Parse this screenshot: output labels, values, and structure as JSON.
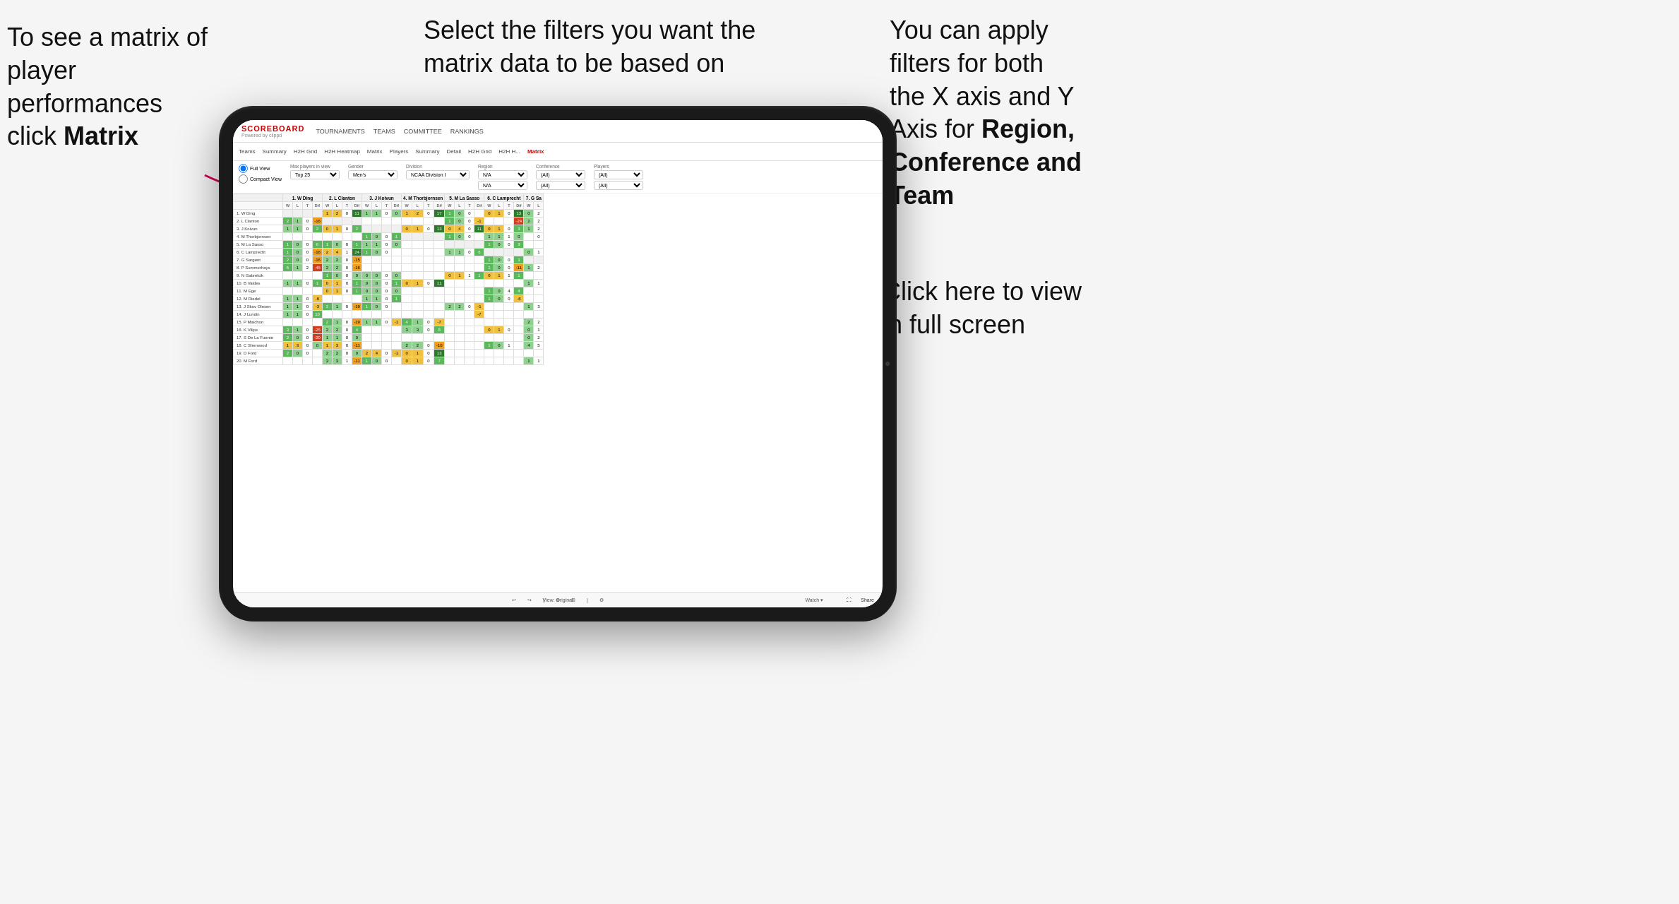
{
  "annotations": {
    "left": {
      "line1": "To see a matrix of",
      "line2": "player performances",
      "line3_plain": "click ",
      "line3_bold": "Matrix"
    },
    "center": {
      "text": "Select the filters you want the matrix data to be based on"
    },
    "right_top": {
      "line1": "You  can apply",
      "line2": "filters for both",
      "line3": "the X axis and Y",
      "line4_plain": "Axis for ",
      "line4_bold": "Region,",
      "line5_bold": "Conference and",
      "line6_bold": "Team"
    },
    "right_bottom": {
      "line1": "Click here to view",
      "line2": "in full screen"
    }
  },
  "nav": {
    "logo_main": "SCOREBOARD",
    "logo_sub": "Powered by clippd",
    "items": [
      "TOURNAMENTS",
      "TEAMS",
      "COMMITTEE",
      "RANKINGS"
    ]
  },
  "subnav": {
    "items": [
      "Teams",
      "Summary",
      "H2H Grid",
      "H2H Heatmap",
      "Matrix",
      "Players",
      "Summary",
      "Detail",
      "H2H Grid",
      "H2H H...",
      "Matrix"
    ],
    "active_index": 10
  },
  "filters": {
    "view_options": [
      "Full View",
      "Compact View"
    ],
    "max_players_label": "Max players in view",
    "max_players_value": "Top 25",
    "gender_label": "Gender",
    "gender_value": "Men's",
    "division_label": "Division",
    "division_value": "NCAA Division I",
    "region_label": "Region",
    "region_values": [
      "N/A",
      "N/A"
    ],
    "conference_label": "Conference",
    "conference_values": [
      "(All)",
      "(All)"
    ],
    "players_label": "Players",
    "players_values": [
      "(All)",
      "(All)"
    ]
  },
  "matrix": {
    "col_headers": [
      "1. W Ding",
      "2. L Clanton",
      "3. J Koivun",
      "4. M Thorbjornsen",
      "5. M La Sasso",
      "6. C Lamprecht",
      "7. G Sa"
    ],
    "sub_headers": [
      "W",
      "L",
      "T",
      "Dif"
    ],
    "rows": [
      {
        "name": "1. W Ding",
        "cells": [
          [
            null,
            null,
            null,
            null
          ],
          [
            1,
            2,
            0,
            11
          ],
          [
            1,
            1,
            0,
            0
          ],
          [
            1,
            2,
            0,
            17
          ],
          [
            1,
            0,
            0,
            null
          ],
          [
            0,
            1,
            0,
            13
          ],
          [
            0,
            2
          ]
        ]
      },
      {
        "name": "2. L Clanton",
        "cells": [
          [
            2,
            1,
            0,
            -16
          ],
          [
            null,
            null,
            null,
            null
          ],
          [
            null,
            null,
            null,
            null
          ],
          [
            null,
            null,
            null,
            null
          ],
          [
            1,
            0,
            0,
            -1
          ],
          [
            null,
            null,
            null,
            -24
          ],
          [
            2,
            2
          ]
        ]
      },
      {
        "name": "3. J Koivun",
        "cells": [
          [
            1,
            1,
            0,
            2
          ],
          [
            0,
            1,
            0,
            2
          ],
          [
            null,
            null,
            null,
            null
          ],
          [
            0,
            1,
            0,
            13
          ],
          [
            0,
            4,
            0,
            11
          ],
          [
            0,
            1,
            0,
            3
          ],
          [
            1,
            2
          ]
        ]
      },
      {
        "name": "4. M Thorbjornsen",
        "cells": [
          [
            null,
            null,
            null,
            null
          ],
          [
            null,
            null,
            null,
            null
          ],
          [
            1,
            0,
            0,
            1
          ],
          [
            null,
            null,
            null,
            null
          ],
          [
            1,
            0,
            0,
            null
          ],
          [
            1,
            1,
            1,
            0
          ],
          [
            null,
            0
          ]
        ]
      },
      {
        "name": "5. M La Sasso",
        "cells": [
          [
            1,
            0,
            0,
            6
          ],
          [
            1,
            0,
            0,
            1
          ],
          [
            1,
            1,
            0,
            0
          ],
          [
            null,
            null,
            null,
            null
          ],
          [
            null,
            null,
            null,
            null
          ],
          [
            1,
            0,
            0,
            3
          ],
          [
            null,
            null
          ]
        ]
      },
      {
        "name": "6. C Lamprecht",
        "cells": [
          [
            1,
            0,
            0,
            -16
          ],
          [
            2,
            4,
            1,
            24
          ],
          [
            1,
            0,
            0,
            null
          ],
          [
            null,
            null,
            null,
            null
          ],
          [
            1,
            1,
            0,
            6
          ],
          [
            null,
            null,
            null,
            null
          ],
          [
            0,
            1
          ]
        ]
      },
      {
        "name": "7. G Sargent",
        "cells": [
          [
            2,
            0,
            0,
            -16
          ],
          [
            2,
            2,
            0,
            -15
          ],
          [
            null,
            null,
            null,
            null
          ],
          [
            null,
            null,
            null,
            null
          ],
          [
            null,
            null,
            null,
            null
          ],
          [
            1,
            0,
            0,
            3
          ],
          [
            null,
            null
          ]
        ]
      },
      {
        "name": "8. P Summerhays",
        "cells": [
          [
            5,
            1,
            2,
            -45
          ],
          [
            2,
            2,
            0,
            -16
          ],
          [
            null,
            null,
            null,
            null
          ],
          [
            null,
            null,
            null,
            null
          ],
          [
            null,
            null,
            null,
            null
          ],
          [
            1,
            0,
            0,
            -11
          ],
          [
            1,
            2
          ]
        ]
      },
      {
        "name": "9. N Gabrelcik",
        "cells": [
          [
            null,
            null,
            null,
            null
          ],
          [
            1,
            0,
            0,
            0
          ],
          [
            0,
            0,
            0,
            0
          ],
          [
            null,
            null,
            null,
            null
          ],
          [
            0,
            1,
            1,
            1
          ],
          [
            0,
            1,
            1,
            1
          ],
          [
            null,
            null
          ]
        ]
      },
      {
        "name": "10. B Valdes",
        "cells": [
          [
            1,
            1,
            0,
            1
          ],
          [
            0,
            1,
            0,
            1
          ],
          [
            0,
            0,
            0,
            1
          ],
          [
            0,
            1,
            0,
            11
          ],
          [
            null,
            null,
            null,
            null
          ],
          [
            null,
            null,
            null,
            null
          ],
          [
            1,
            1
          ]
        ]
      },
      {
        "name": "11. M Ege",
        "cells": [
          [
            null,
            null,
            null,
            null
          ],
          [
            0,
            1,
            0,
            1
          ],
          [
            0,
            0,
            0,
            0
          ],
          [
            null,
            null,
            null,
            null
          ],
          [
            null,
            null,
            null,
            null
          ],
          [
            1,
            0,
            4,
            4
          ],
          [
            null,
            null
          ]
        ]
      },
      {
        "name": "12. M Riedel",
        "cells": [
          [
            1,
            1,
            0,
            -6
          ],
          [
            null,
            null,
            null,
            null
          ],
          [
            1,
            1,
            0,
            1
          ],
          [
            null,
            null,
            null,
            null
          ],
          [
            null,
            null,
            null,
            null
          ],
          [
            1,
            0,
            0,
            -6
          ],
          [
            null,
            null
          ]
        ]
      },
      {
        "name": "13. J Skov Olesen",
        "cells": [
          [
            1,
            1,
            0,
            -3
          ],
          [
            2,
            1,
            0,
            -19
          ],
          [
            1,
            0,
            0,
            null
          ],
          [
            null,
            null,
            null,
            null
          ],
          [
            2,
            2,
            0,
            -1
          ],
          [
            null,
            null,
            null,
            null
          ],
          [
            1,
            3
          ]
        ]
      },
      {
        "name": "14. J Lundin",
        "cells": [
          [
            1,
            1,
            0,
            10
          ],
          [
            null,
            null,
            null,
            null
          ],
          [
            null,
            null,
            null,
            null
          ],
          [
            null,
            null,
            null,
            null
          ],
          [
            null,
            null,
            null,
            -7
          ],
          [
            null,
            null,
            null,
            null
          ],
          [
            null,
            null
          ]
        ]
      },
      {
        "name": "15. P Maichon",
        "cells": [
          [
            null,
            null,
            null,
            null
          ],
          [
            2,
            1,
            0,
            -19
          ],
          [
            1,
            1,
            0,
            -1
          ],
          [
            4,
            1,
            0,
            -7
          ],
          [
            null,
            null,
            null,
            null
          ],
          [
            null,
            null,
            null,
            null
          ],
          [
            2,
            2
          ]
        ]
      },
      {
        "name": "16. K Vilips",
        "cells": [
          [
            3,
            1,
            0,
            -25
          ],
          [
            2,
            2,
            0,
            4
          ],
          [
            null,
            null,
            null,
            null
          ],
          [
            3,
            3,
            0,
            8
          ],
          [
            null,
            null,
            null,
            null
          ],
          [
            0,
            1,
            0,
            null
          ],
          [
            0,
            1
          ]
        ]
      },
      {
        "name": "17. S De La Fuente",
        "cells": [
          [
            2,
            0,
            0,
            -20
          ],
          [
            1,
            1,
            0,
            0
          ],
          [
            null,
            null,
            null,
            null
          ],
          [
            null,
            null,
            null,
            null
          ],
          [
            null,
            null,
            null,
            null
          ],
          [
            null,
            null,
            null,
            null
          ],
          [
            0,
            2
          ]
        ]
      },
      {
        "name": "18. C Sherwood",
        "cells": [
          [
            1,
            3,
            0,
            0
          ],
          [
            1,
            3,
            0,
            -11
          ],
          [
            null,
            null,
            null,
            null
          ],
          [
            2,
            2,
            0,
            -10
          ],
          [
            null,
            null,
            null,
            null
          ],
          [
            1,
            0,
            1,
            null
          ],
          [
            4,
            5
          ]
        ]
      },
      {
        "name": "19. D Ford",
        "cells": [
          [
            2,
            0,
            0,
            null
          ],
          [
            2,
            2,
            0,
            0
          ],
          [
            2,
            4,
            0,
            -1
          ],
          [
            0,
            1,
            0,
            13
          ],
          [
            null,
            null,
            null,
            null
          ],
          [
            null,
            null,
            null,
            null
          ],
          [
            null,
            null
          ]
        ]
      },
      {
        "name": "20. M Ford",
        "cells": [
          [
            null,
            null,
            null,
            null
          ],
          [
            3,
            3,
            1,
            -11
          ],
          [
            1,
            0,
            0,
            null
          ],
          [
            0,
            1,
            0,
            7
          ],
          [
            null,
            null,
            null,
            null
          ],
          [
            null,
            null,
            null,
            null
          ],
          [
            1,
            1
          ]
        ]
      }
    ]
  },
  "toolbar": {
    "view_label": "View: Original",
    "watch_label": "Watch ▾",
    "share_label": "Share"
  }
}
